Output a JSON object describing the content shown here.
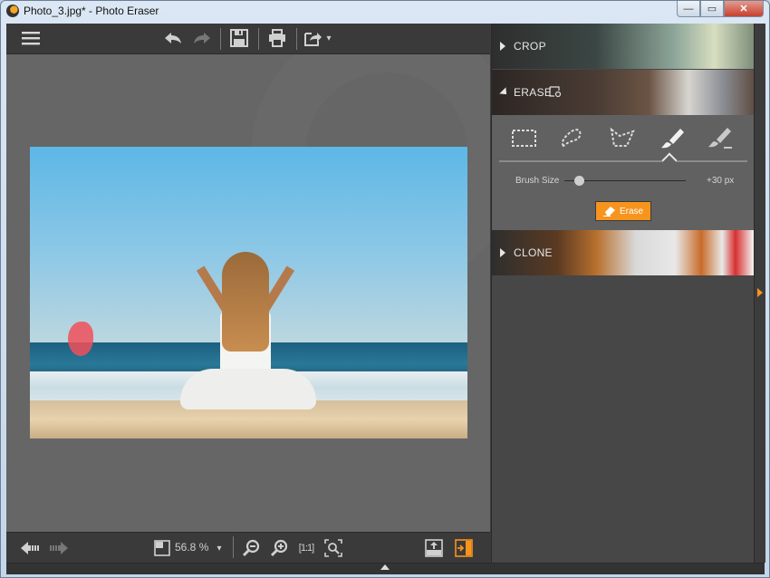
{
  "window": {
    "title": "Photo_3.jpg* - Photo Eraser",
    "controls": {
      "minimize": "—",
      "maximize": "▭",
      "close": "✕"
    }
  },
  "toolbar": {
    "menu_icon": "☰",
    "undo_icon": "↶",
    "redo_icon": "↷",
    "save_icon": "💾",
    "print_icon": "🖶",
    "export_icon": "⇪",
    "export_dropdown": "▾"
  },
  "canvas": {
    "image_description": "Woman meditating on beach; seagull marked in red for erasing"
  },
  "bottombar": {
    "prev_icon": "⇦",
    "next_icon": "⇨",
    "zoom_value": "56.8 %",
    "zoom_dropdown": "▾",
    "zoom_out_icon": "⊖",
    "zoom_in_icon": "⊕",
    "actual_size_label": "[1:1]",
    "fit_icon": "⌕"
  },
  "panel": {
    "sections": [
      {
        "id": "crop",
        "label": "CROP",
        "expanded": false
      },
      {
        "id": "erase",
        "label": "ERASE",
        "expanded": true
      },
      {
        "id": "clone",
        "label": "CLONE",
        "expanded": false
      }
    ],
    "erase": {
      "tools": [
        "rectangle-select",
        "lasso-select",
        "polygon-select",
        "brush",
        "eraser-brush"
      ],
      "active_tool": "brush",
      "brush_size_label": "Brush Size",
      "brush_size_value": "+30 px",
      "brush_size_fraction": 0.12,
      "erase_button": "Erase"
    }
  },
  "colors": {
    "accent": "#f7941d",
    "panel_bg": "#474747",
    "canvas_bg": "#666666",
    "toolbar_bg": "#3a3a3a"
  }
}
